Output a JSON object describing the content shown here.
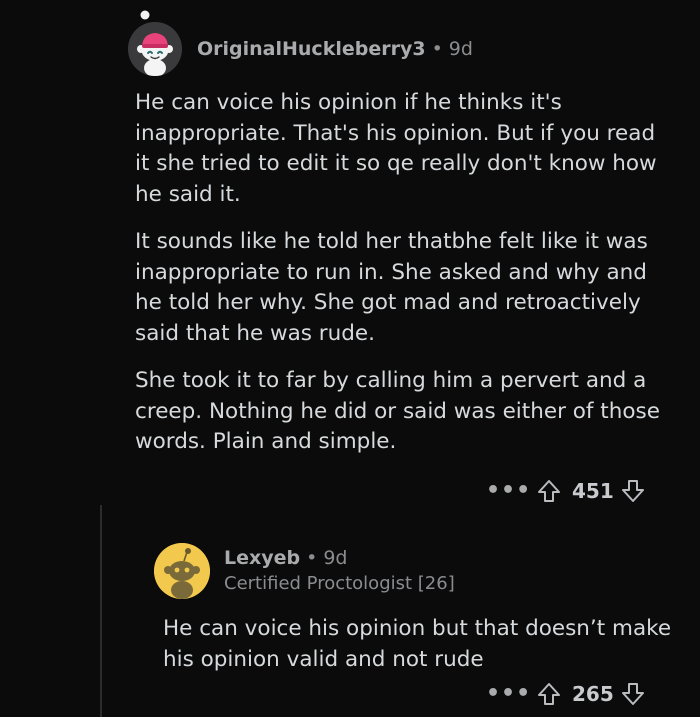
{
  "comment": {
    "author": "OriginalHuckleberry3",
    "separator": "•",
    "age": "9d",
    "paragraphs": [
      "He can voice his opinion if he thinks it's inappropriate. That's his opinion. But if you read it she tried to edit it so qe really don't know how he said it.",
      "It sounds like he told her thatbhe felt like it was inappropriate to run in. She asked and why and he told her why. She got mad and retroactively said that he was rude.",
      "She took it to far by calling him a pervert and a creep. Nothing he did or said was either of those words. Plain and simple."
    ],
    "more_label": "•••",
    "score": "451",
    "avatar_icon": "snoo-avatar-icon",
    "avatar_color": "#3a3a3c"
  },
  "reply": {
    "author": "Lexyeb",
    "separator": "•",
    "age": "9d",
    "flair": "Certified Proctologist [26]",
    "text": "He can voice his opinion but that doesn’t make his opinion valid and not rude",
    "more_label": "•••",
    "score": "265",
    "avatar_icon": "snoo-avatar-icon",
    "avatar_color": "#f2c94c"
  },
  "icons": {
    "upvote": "upvote-arrow-icon",
    "downvote": "downvote-arrow-icon",
    "more": "more-options-icon"
  },
  "colors": {
    "background": "#0b0b0b",
    "text": "#d7dadc",
    "meta": "#8a8c8f"
  }
}
